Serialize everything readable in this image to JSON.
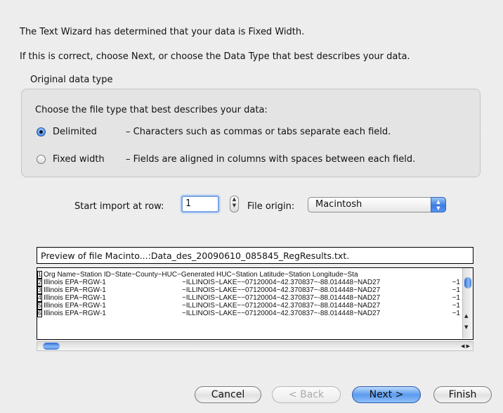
{
  "intro": {
    "line1": "The Text Wizard has determined that your data is Fixed Width.",
    "line2": "If this is correct, choose Next, or choose the Data Type that best describes your data."
  },
  "group": {
    "title": "Original data type",
    "choose_label": "Choose the file type that best describes your data:",
    "options": [
      {
        "label": "Delimited",
        "description": "– Characters such as commas or tabs separate each field.",
        "selected": true
      },
      {
        "label": "Fixed width",
        "description": "– Fields are aligned in columns with spaces between each field.",
        "selected": false
      }
    ]
  },
  "import": {
    "start_row_label": "Start import at row:",
    "start_row_value": "1",
    "file_origin_label": "File origin:",
    "file_origin_value": "Macintosh"
  },
  "preview": {
    "title": "Preview of file Macinto...:Data_des_20090610_085845_RegResults.txt.",
    "rows": [
      {
        "num": "1",
        "cells": [
          "Org Name~Station ID~State~County~HUC~Generated HUC~Station Latitude~Station Longitude~Sta",
          "",
          ""
        ]
      },
      {
        "num": "2",
        "cells": [
          "Illinois EPA~RGW-1",
          "~ILLINOIS~LAKE~~07120004~42.370837~-88.014448~NAD27",
          "~1"
        ]
      },
      {
        "num": "3",
        "cells": [
          "Illinois EPA~RGW-1",
          "~ILLINOIS~LAKE~~07120004~42.370837~-88.014448~NAD27",
          "~1"
        ]
      },
      {
        "num": "4",
        "cells": [
          "Illinois EPA~RGW-1",
          "~ILLINOIS~LAKE~~07120004~42.370837~-88.014448~NAD27",
          "~1"
        ]
      },
      {
        "num": "5",
        "cells": [
          "Illinois EPA~RGW-1",
          "~ILLINOIS~LAKE~~07120004~42.370837~-88.014448~NAD27",
          "~1"
        ]
      },
      {
        "num": "6",
        "cells": [
          "Illinois EPA~RGW-1",
          "~ILLINOIS~LAKE~~07120004~42.370837~-88.014448~NAD27",
          "~1"
        ]
      }
    ]
  },
  "buttons": {
    "cancel": "Cancel",
    "back": "< Back",
    "next": "Next >",
    "finish": "Finish"
  },
  "icons": {
    "stepper_up": "▲",
    "stepper_down": "▼",
    "select_up": "▲",
    "select_down": "▼",
    "scroll_up": "▲",
    "scroll_down": "▼",
    "scroll_left": "◀",
    "scroll_right": "▶"
  },
  "colors": {
    "accent": "#5b9aee",
    "selected_radio": "#2f6cc6"
  }
}
